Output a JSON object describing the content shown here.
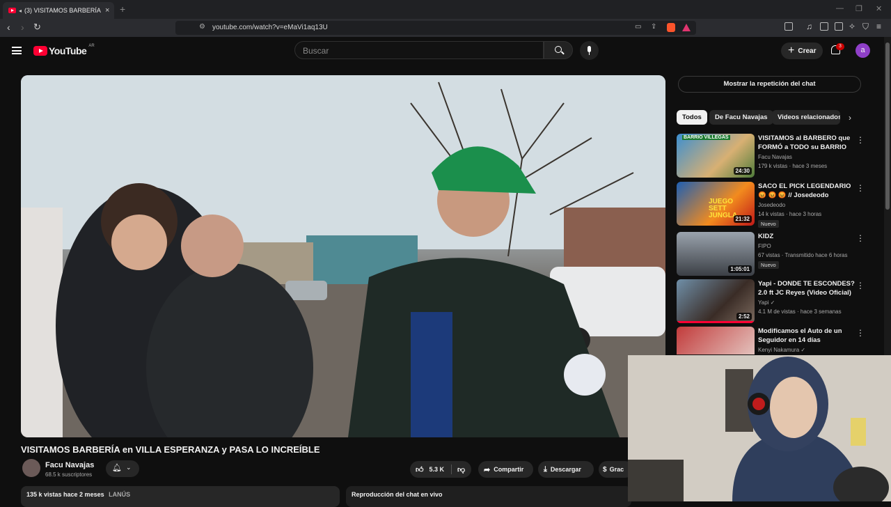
{
  "browser": {
    "tab_title": "(3) VISITAMOS BARBERÍA en",
    "new_tab": "+",
    "url": "youtube.com/watch?v=eMaVi1aq13U"
  },
  "header": {
    "logo_text": "YouTube",
    "country_code": "AR",
    "search_placeholder": "Buscar",
    "create_label": "Crear",
    "notification_count": "3",
    "avatar_letter": "a"
  },
  "video": {
    "title": "VISITAMOS BARBERÍA en VILLA ESPERANZA y PASA LO INCREÍBLE",
    "channel_name": "Facu Navajas",
    "subscribers": "68.5 k suscriptores",
    "likes": "5.3 K",
    "share_label": "Compartir",
    "download_label": "Descargar",
    "thanks_label": "Grac",
    "description_stats": "135 k vistas  hace 2 meses",
    "description_tag": "LANÚS",
    "chat_replay_label": "Reproducción del chat en vivo"
  },
  "sidebar": {
    "show_chat_label": "Mostrar la repetición del chat",
    "chips": [
      "Todos",
      "De Facu Navajas",
      "Videos relacionados"
    ],
    "recommendations": [
      {
        "title": "VISITAMOS al BARBERO que FORMÓ a TODO su BARRIO en...",
        "channel": "Facu Navajas",
        "meta": "179 k vistas · hace 3 meses",
        "duration": "24:30",
        "thumb_text": "BARRIO VILLEGAS",
        "badge": ""
      },
      {
        "title": "SACO EL PICK LEGENDARIO 😡 😡 😡 // Josedeodo",
        "channel": "Josedeodo",
        "meta": "14 k vistas · hace 3 horas",
        "duration": "21:32",
        "thumb_text": "JUEGO SETT JUNGLA",
        "badge": "Nuevo"
      },
      {
        "title": "KIDZ",
        "channel": "FIPO",
        "meta": "67 vistas · Transmitido hace 6 horas",
        "duration": "1:05:01",
        "thumb_text": "",
        "badge": "Nuevo"
      },
      {
        "title": "Yapi - DONDE TE ESCONDES? 2.0 ft JC Reyes (Video Oficial)",
        "channel": "Yapi ✓",
        "meta": "4.1 M de vistas · hace 3 semanas",
        "duration": "2:52",
        "thumb_text": "",
        "badge": ""
      },
      {
        "title": "Modificamos el Auto de un Seguidor en 14 días",
        "channel": "Kenyi Nakamura ✓",
        "meta": "",
        "duration": "",
        "thumb_text": "",
        "badge": ""
      }
    ]
  },
  "colors": {
    "brand_red": "#ff0033",
    "avatar_purple": "#8f3fc8",
    "bg": "#0f0f0f"
  }
}
